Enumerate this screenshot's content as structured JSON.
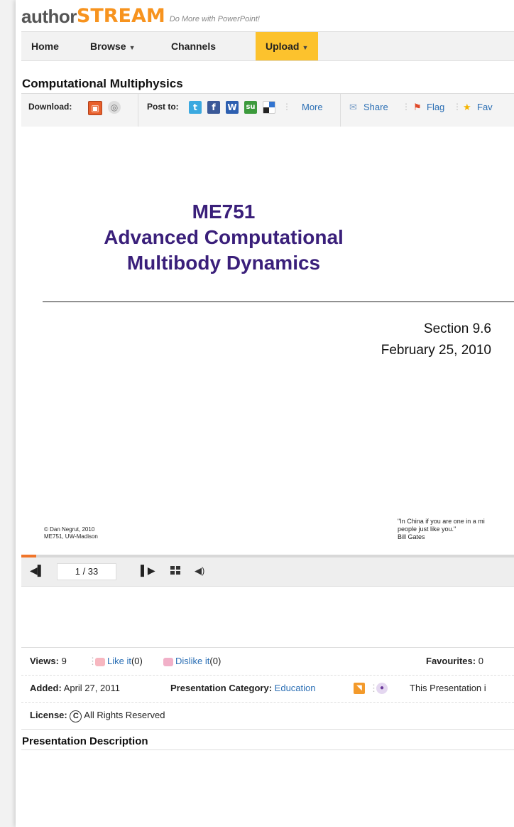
{
  "brand": {
    "author": "author",
    "stream": "STREAM",
    "tagline": "Do More with PowerPoint!"
  },
  "nav": {
    "home": "Home",
    "browse": "Browse",
    "channels": "Channels",
    "upload": "Upload"
  },
  "presentation": {
    "title": "Computational Multiphysics"
  },
  "toolbar": {
    "download_label": "Download:",
    "post_label": "Post to:",
    "more": "More",
    "share": "Share",
    "flag": "Flag",
    "fav": "Fav"
  },
  "slide": {
    "title_line1": "ME751",
    "title_line2": "Advanced Computational",
    "title_line3": "Multibody Dynamics",
    "section": "Section 9.6",
    "date": "February 25, 2010",
    "copyright_line1": "© Dan Negrut, 2010",
    "copyright_line2": "ME751, UW-Madison",
    "quote_line1": "\"In China if you are one in a mi",
    "quote_line2": "people just like you.\"",
    "quote_author": "Bill Gates"
  },
  "player": {
    "page_indicator": "1 / 33",
    "progress": 0.03
  },
  "stats": {
    "views_label": "Views:",
    "views_value": "9",
    "like_label": "Like it",
    "like_count": "(0)",
    "dislike_label": "Dislike it",
    "dislike_count": "(0)",
    "favourites_label": "Favourites:",
    "favourites_value": "0",
    "added_label": "Added:",
    "added_value": "April 27, 2011",
    "category_label": "Presentation Category:",
    "category_value": "Education",
    "presentation_note": "This Presentation i",
    "license_label": "License:",
    "license_value": "All Rights Reserved"
  },
  "description": {
    "heading": "Presentation Description"
  },
  "colors": {
    "accent_orange": "#f7931e",
    "upload_yellow": "#fcc22d",
    "slide_purple": "#3a1f7a",
    "link_blue": "#2a6eb4"
  }
}
